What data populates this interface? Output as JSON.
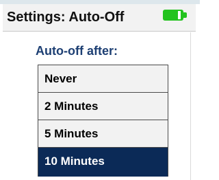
{
  "header": {
    "title": "Settings: Auto-Off",
    "battery_icon": "battery-icon",
    "battery_color": "#23c31e"
  },
  "content": {
    "section_label": "Auto-off after:",
    "options": [
      {
        "label": "Never",
        "selected": false
      },
      {
        "label": "2 Minutes",
        "selected": false
      },
      {
        "label": "5 Minutes",
        "selected": false
      },
      {
        "label": "10 Minutes",
        "selected": true
      }
    ],
    "selected_color": "#0b2a57",
    "label_color": "#1d3f73"
  }
}
